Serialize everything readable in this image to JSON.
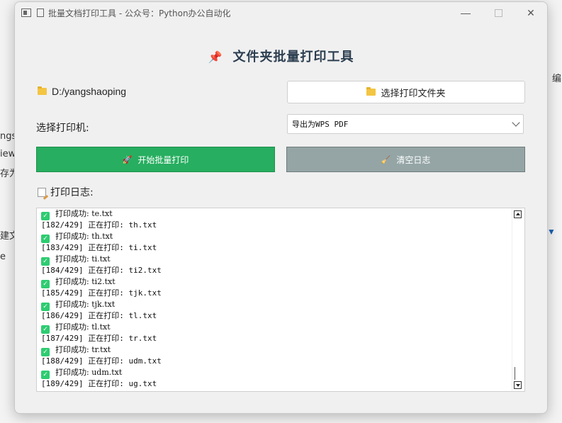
{
  "window": {
    "title": "批量文档打印工具 - 公众号：Python办公自动化",
    "minimize_glyph": "—",
    "close_glyph": "✕"
  },
  "heading": {
    "icon": "pushpin-icon",
    "pin_glyph": "📌",
    "text": "文件夹批量打印工具"
  },
  "folder": {
    "icon": "folder-icon",
    "path": "D:/yangshaoping"
  },
  "choose_button": {
    "label": "选择打印文件夹"
  },
  "printer": {
    "label": "选择打印机:",
    "selected": "导出为WPS PDF"
  },
  "start_button": {
    "icon": "rocket-icon",
    "glyph": "🚀",
    "label": "开始批量打印",
    "color": "#27ae60"
  },
  "clear_button": {
    "icon": "broom-icon",
    "glyph": "🧹",
    "label": "清空日志",
    "color": "#95a5a6"
  },
  "log": {
    "label": "打印日志:",
    "lines": [
      {
        "type": "ok",
        "text": "打印成功: te.txt"
      },
      {
        "type": "progress",
        "text": "[182/429] 正在打印: th.txt"
      },
      {
        "type": "ok",
        "text": "打印成功: th.txt"
      },
      {
        "type": "progress",
        "text": "[183/429] 正在打印: ti.txt"
      },
      {
        "type": "ok",
        "text": "打印成功: ti.txt"
      },
      {
        "type": "progress",
        "text": "[184/429] 正在打印: ti2.txt"
      },
      {
        "type": "ok",
        "text": "打印成功: ti2.txt"
      },
      {
        "type": "progress",
        "text": "[185/429] 正在打印: tjk.txt"
      },
      {
        "type": "ok",
        "text": "打印成功: tjk.txt"
      },
      {
        "type": "progress",
        "text": "[186/429] 正在打印: tl.txt"
      },
      {
        "type": "ok",
        "text": "打印成功: tl.txt"
      },
      {
        "type": "progress",
        "text": "[187/429] 正在打印: tr.txt"
      },
      {
        "type": "ok",
        "text": "打印成功: tr.txt"
      },
      {
        "type": "progress",
        "text": "[188/429] 正在打印: udm.txt"
      },
      {
        "type": "ok",
        "text": "打印成功: udm.txt"
      },
      {
        "type": "progress",
        "text": "[189/429] 正在打印: ug.txt"
      }
    ]
  },
  "background": {
    "fragments": [
      "ngsh",
      "iew",
      "存为",
      "建文件",
      "e",
      "编"
    ]
  }
}
